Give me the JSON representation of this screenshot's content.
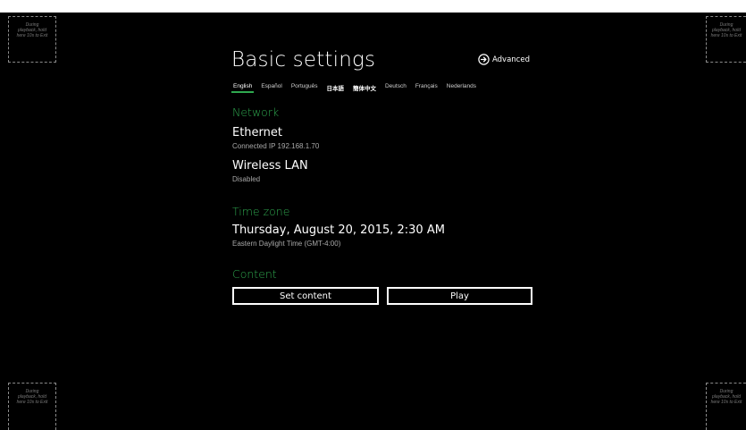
{
  "corner_hint": {
    "lines": [
      "During",
      "playback, hold",
      "here 10s to Exit"
    ]
  },
  "header": {
    "title": "Basic settings",
    "advanced_label": "Advanced"
  },
  "languages": {
    "items": [
      "English",
      "Español",
      "Português",
      "日本語",
      "簡体中文",
      "Deutsch",
      "Français",
      "Nederlands"
    ],
    "selected": "English"
  },
  "network": {
    "header": "Network",
    "ethernet": {
      "title": "Ethernet",
      "status": "Connected IP 192.168.1.70"
    },
    "wireless": {
      "title": "Wireless LAN",
      "status": "Disabled"
    }
  },
  "time_zone": {
    "header": "Time zone",
    "datetime": "Thursday, August 20, 2015, 2:30 AM",
    "zone": "Eastern Daylight Time (GMT-4:00)"
  },
  "content": {
    "header": "Content",
    "set_content_label": "Set content",
    "play_label": "Play"
  },
  "colors": {
    "accent": "#2fa84f",
    "background": "#000000",
    "text": "#ffffff"
  }
}
